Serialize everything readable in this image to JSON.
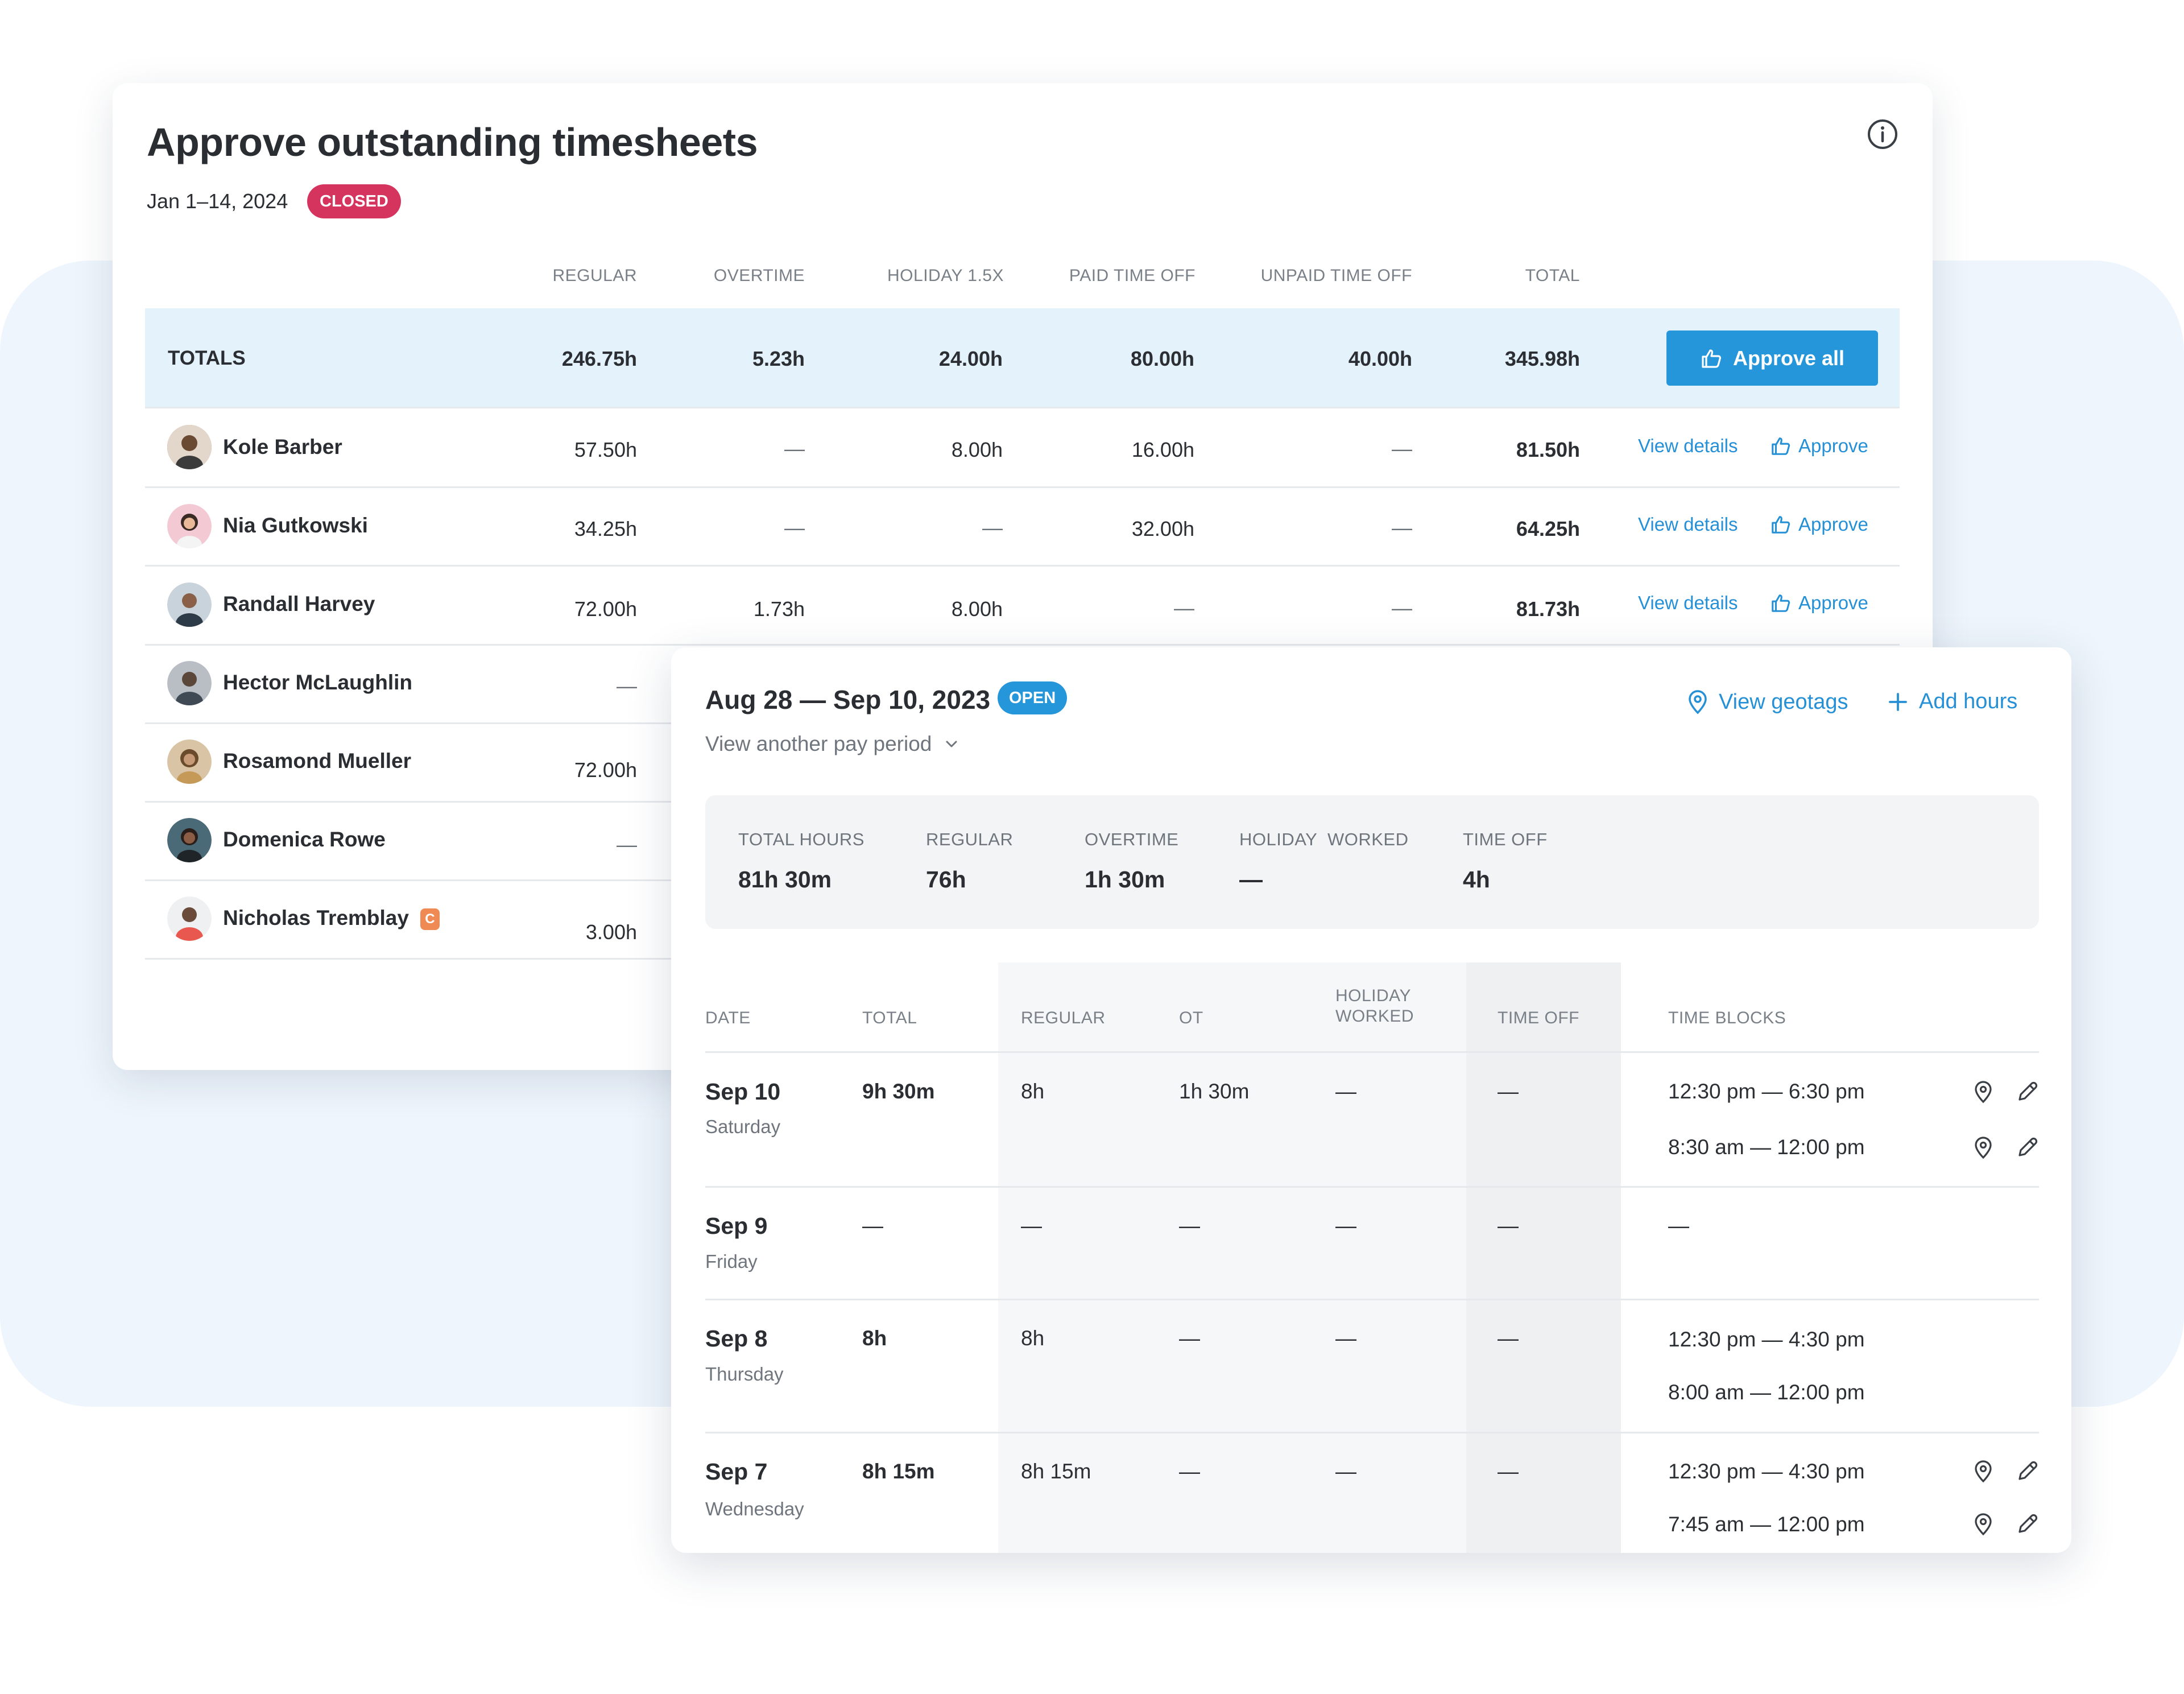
{
  "approve_card": {
    "title": "Approve outstanding timesheets",
    "date_range": "Jan 1–14, 2024",
    "status_badge": "CLOSED",
    "columns": [
      "REGULAR",
      "OVERTIME",
      "HOLIDAY 1.5X",
      "PAID TIME OFF",
      "UNPAID TIME OFF",
      "TOTAL"
    ],
    "totals": {
      "label": "TOTALS",
      "regular": "246.75h",
      "overtime": "5.23h",
      "holiday": "24.00h",
      "paid_time_off": "80.00h",
      "unpaid_time_off": "40.00h",
      "total": "345.98h",
      "approve_all": "Approve all"
    },
    "view_details": "View details",
    "approve": "Approve",
    "employees": [
      {
        "name": "Kole Barber",
        "regular": "57.50h",
        "overtime": "—",
        "holiday": "8.00h",
        "pto": "16.00h",
        "upto": "—",
        "total": "81.50h"
      },
      {
        "name": "Nia Gutkowski",
        "regular": "34.25h",
        "overtime": "—",
        "holiday": "—",
        "pto": "32.00h",
        "upto": "—",
        "total": "64.25h"
      },
      {
        "name": "Randall Harvey",
        "regular": "72.00h",
        "overtime": "1.73h",
        "holiday": "8.00h",
        "pto": "—",
        "upto": "—",
        "total": "81.73h"
      },
      {
        "name": "Hector McLaughlin",
        "regular": "—"
      },
      {
        "name": "Rosamond Mueller",
        "regular": "72.00h"
      },
      {
        "name": "Domenica Rowe",
        "regular": "—"
      },
      {
        "name": "Nicholas Tremblay",
        "regular": "3.00h",
        "badge": "C"
      }
    ]
  },
  "detail_card": {
    "period": "Aug 28 — Sep 10, 2023",
    "status_badge": "OPEN",
    "another_period": "View another pay period",
    "view_geotags": "View geotags",
    "add_hours": "Add hours",
    "summary": [
      {
        "label": "TOTAL HOURS",
        "value": "81h 30m"
      },
      {
        "label": "REGULAR",
        "value": "76h"
      },
      {
        "label": "OVERTIME",
        "value": "1h 30m"
      },
      {
        "label": "HOLIDAY  WORKED",
        "value": "—"
      },
      {
        "label": "TIME OFF",
        "value": "4h"
      }
    ],
    "columns": {
      "date": "DATE",
      "total": "TOTAL",
      "regular": "REGULAR",
      "ot": "OT",
      "holiday_line1": "HOLIDAY",
      "holiday_line2": "WORKED",
      "time_off": "TIME OFF",
      "time_blocks": "TIME BLOCKS"
    },
    "days": [
      {
        "date": "Sep 10",
        "weekday": "Saturday",
        "total": "9h 30m",
        "regular": "8h",
        "ot": "1h 30m",
        "holiday": "—",
        "time_off": "—",
        "blocks": [
          "12:30 pm — 6:30 pm",
          "8:30 am — 12:00 pm"
        ]
      },
      {
        "date": "Sep 9",
        "weekday": "Friday",
        "total": "—",
        "regular": "—",
        "ot": "—",
        "holiday": "—",
        "time_off": "—",
        "blocks": [
          "—"
        ]
      },
      {
        "date": "Sep 8",
        "weekday": "Thursday",
        "total": "8h",
        "regular": "8h",
        "ot": "—",
        "holiday": "—",
        "time_off": "—",
        "blocks": [
          "12:30 pm — 4:30 pm",
          "8:00 am — 12:00 pm"
        ]
      },
      {
        "date": "Sep 7",
        "weekday": "Wednesday",
        "total": "8h 15m",
        "regular": "8h 15m",
        "ot": "—",
        "holiday": "—",
        "time_off": "—",
        "blocks": [
          "12:30 pm — 4:30 pm",
          "7:45 am — 12:00 pm"
        ]
      }
    ]
  },
  "colors": {
    "accent_blue": "#2596d9",
    "closed_red": "#d5345e",
    "totals_bg": "#e4f2fb",
    "backdrop": "#eef5fc",
    "c_badge": "#ef8a55"
  },
  "icons": [
    "info-icon",
    "thumbs-up-icon",
    "chevron-down-icon",
    "location-pin-icon",
    "plus-icon",
    "pencil-icon"
  ]
}
